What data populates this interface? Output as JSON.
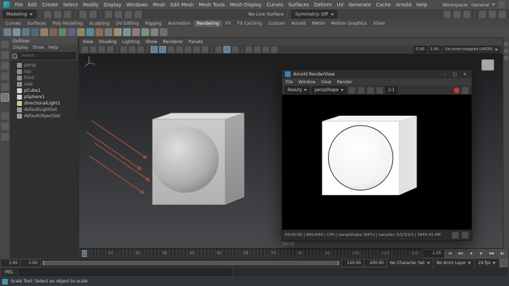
{
  "menubar": {
    "items": [
      "File",
      "Edit",
      "Create",
      "Select",
      "Modify",
      "Display",
      "Windows",
      "Mesh",
      "Edit Mesh",
      "Mesh Tools",
      "Mesh Display",
      "Curves",
      "Surfaces",
      "Deform",
      "UV",
      "Generate",
      "Cache",
      "Arnold",
      "Help"
    ],
    "workspace_label": "Workspace:",
    "workspace_value": "General"
  },
  "statusline": {
    "menuset": "Modeling",
    "no_live_surface": "No Live Surface",
    "symmetry": "Symmetry: Off"
  },
  "shelf": {
    "tabs": [
      "Curves",
      "Surfaces",
      "Poly Modeling",
      "Sculpting",
      "UV Editing",
      "Rigging",
      "Animation",
      "Rendering",
      "FX",
      "FX Caching",
      "Custom",
      "Arnold",
      "MASH",
      "Motion Graphics",
      "XGen"
    ],
    "icon_colors": [
      "#6f7f8d",
      "#8a8f94",
      "#5d7b8a",
      "#4e6a79",
      "#97805f",
      "#8a5d5d",
      "#5d8a6b",
      "#6b5d8a",
      "#8a8a5d",
      "#5d8a8a",
      "#8a6b5d",
      "#7a7a7a",
      "#95957a",
      "#7a9595",
      "#957a7a",
      "#7a957a",
      "#828282",
      "#6d6d6d"
    ]
  },
  "outliner": {
    "tab_title": "Outliner",
    "menus": [
      "Display",
      "Show",
      "Help"
    ],
    "search_placeholder": "Search...",
    "items": [
      {
        "label": "persp",
        "text_color": "#999999",
        "icon_color": "#8f8f8f"
      },
      {
        "label": "top",
        "text_color": "#999999",
        "icon_color": "#8f8f8f"
      },
      {
        "label": "front",
        "text_color": "#999999",
        "icon_color": "#8f8f8f"
      },
      {
        "label": "side",
        "text_color": "#999999",
        "icon_color": "#8f8f8f"
      },
      {
        "label": "pCube1",
        "text_color": "#d9d9d9",
        "icon_color": "#ccd4dd"
      },
      {
        "label": "pSphere1",
        "text_color": "#d9d9d9",
        "icon_color": "#ccd4dd"
      },
      {
        "label": "directionalLight1",
        "text_color": "#d9d9d9",
        "icon_color": "#d6cc7a"
      },
      {
        "label": "defaultLightSet",
        "text_color": "#b8b8b8",
        "icon_color": "#9a9a9a"
      },
      {
        "label": "defaultObjectSet",
        "text_color": "#b8b8b8",
        "icon_color": "#9a9a9a"
      }
    ]
  },
  "viewport": {
    "menus": [
      "View",
      "Shading",
      "Lighting",
      "Show",
      "Renderer",
      "Panels"
    ],
    "exposure": "0.00",
    "gamma": "1.00",
    "view_transform": "Un-tone-mapped (sRGB)",
    "camera_hud": "persp"
  },
  "arnold": {
    "title": "Arnold RenderView",
    "menus": [
      "File",
      "Window",
      "View",
      "Render"
    ],
    "toolbar": {
      "aov": "Beauty",
      "camera": "perspShape",
      "zoom": "1:1"
    },
    "window_controls": {
      "minimize": "–",
      "maximize": "□",
      "close": "×"
    },
    "status": "00:00:00 | 960x540 | CPU | perspShape (94%) | samples 3/3/3/3/3 | 2846.41 MB"
  },
  "timeline": {
    "labels": [
      "1",
      "10",
      "20",
      "30",
      "40",
      "50",
      "60",
      "70",
      "80",
      "90",
      "100",
      "110",
      "120"
    ],
    "current_frame": "1.00"
  },
  "range": {
    "start": "1.00",
    "anim_start": "1.00",
    "end": "120.00",
    "anim_end": "200.00",
    "character_set": "No Character Set",
    "anim_layer": "No Anim Layer",
    "fps": "24 fps"
  },
  "transport": {
    "buttons": [
      "|◀",
      "◀◀",
      "◀",
      "▶",
      "▶▶",
      "▶|"
    ]
  },
  "command_line": {
    "label": "MEL"
  },
  "help_line": {
    "text": "Scale Tool: Select an object to scale"
  }
}
